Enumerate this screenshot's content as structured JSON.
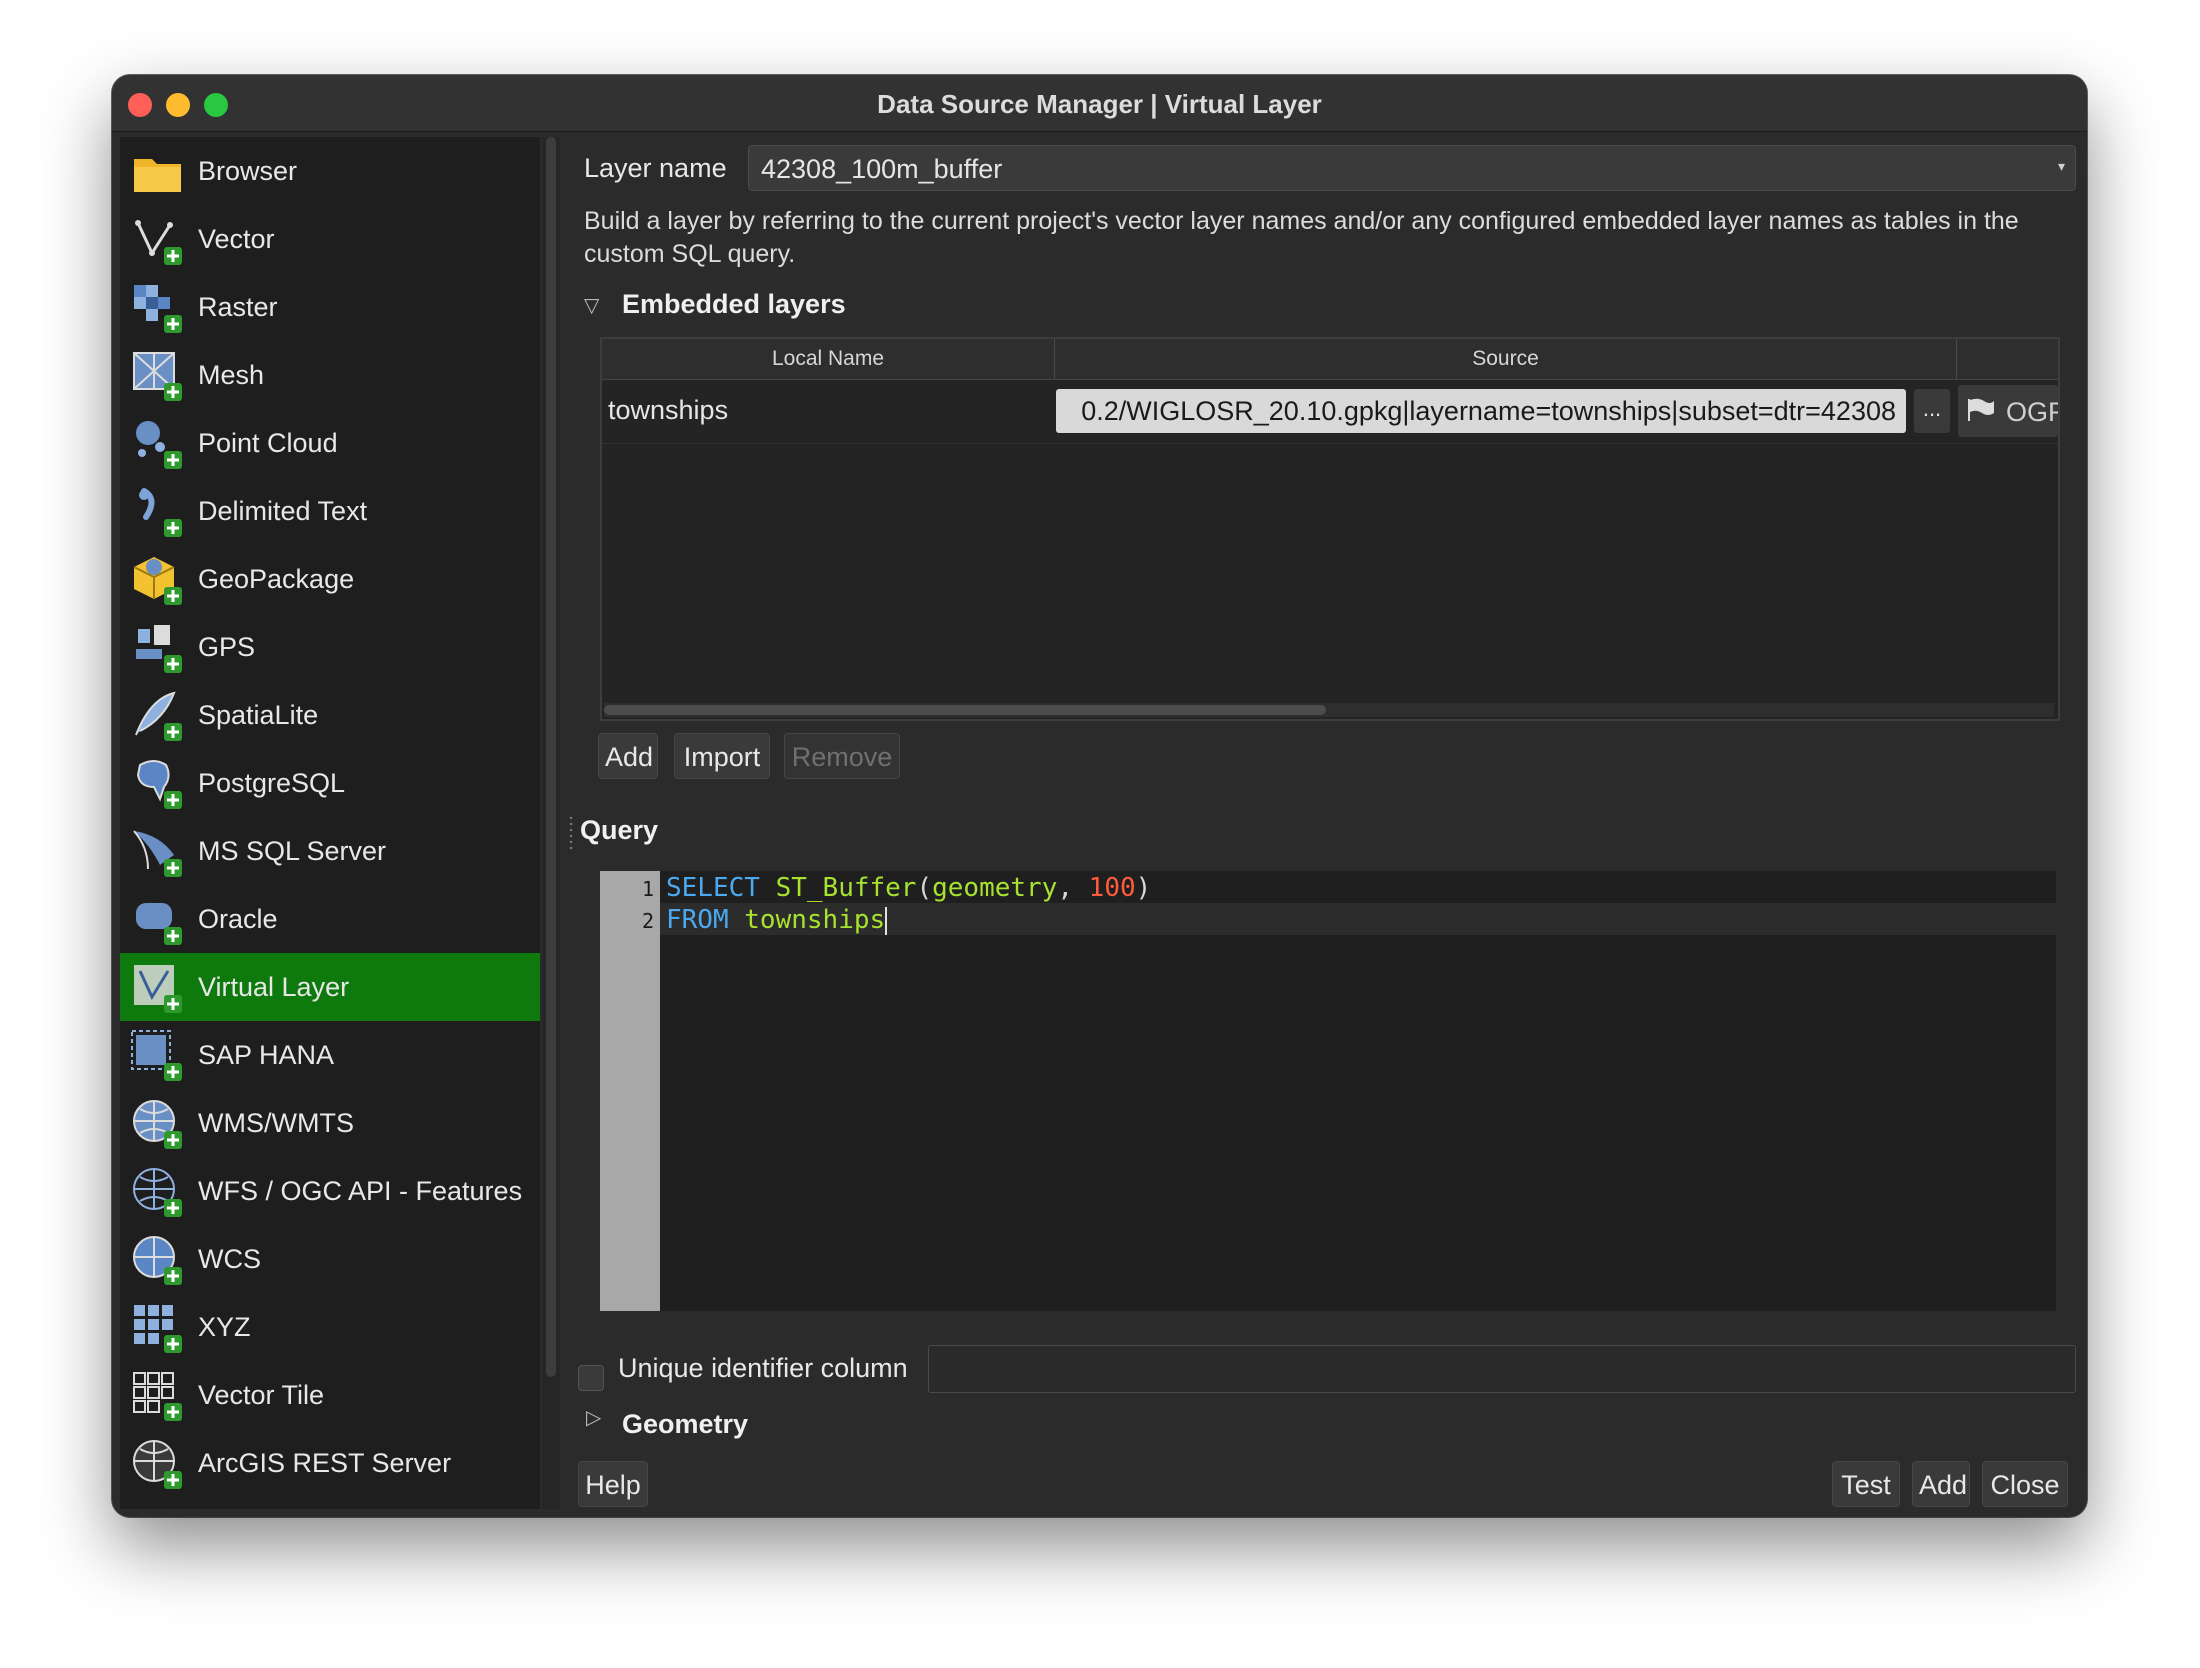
{
  "window": {
    "title": "Data Source Manager | Virtual Layer"
  },
  "sidebar": {
    "items": [
      {
        "label": "Browser",
        "icon": "folder-icon"
      },
      {
        "label": "Vector",
        "icon": "vector-add-icon"
      },
      {
        "label": "Raster",
        "icon": "raster-add-icon"
      },
      {
        "label": "Mesh",
        "icon": "mesh-add-icon"
      },
      {
        "label": "Point Cloud",
        "icon": "point-cloud-add-icon"
      },
      {
        "label": "Delimited Text",
        "icon": "delimited-text-add-icon"
      },
      {
        "label": "GeoPackage",
        "icon": "geopackage-add-icon"
      },
      {
        "label": "GPS",
        "icon": "gps-add-icon"
      },
      {
        "label": "SpatiaLite",
        "icon": "spatialite-add-icon"
      },
      {
        "label": "PostgreSQL",
        "icon": "postgresql-add-icon"
      },
      {
        "label": "MS SQL Server",
        "icon": "mssql-add-icon"
      },
      {
        "label": "Oracle",
        "icon": "oracle-add-icon"
      },
      {
        "label": "Virtual Layer",
        "icon": "virtual-layer-add-icon",
        "selected": true
      },
      {
        "label": "SAP HANA",
        "icon": "sap-hana-add-icon"
      },
      {
        "label": "WMS/WMTS",
        "icon": "wms-add-icon"
      },
      {
        "label": "WFS / OGC API - Features",
        "icon": "wfs-add-icon"
      },
      {
        "label": "WCS",
        "icon": "wcs-add-icon"
      },
      {
        "label": "XYZ",
        "icon": "xyz-add-icon"
      },
      {
        "label": "Vector Tile",
        "icon": "vector-tile-add-icon"
      },
      {
        "label": "ArcGIS REST Server",
        "icon": "arcgis-add-icon"
      }
    ],
    "selected_color": "#0e7a0d"
  },
  "layer": {
    "name_label": "Layer name",
    "name_value": "42308_100m_buffer",
    "description": "Build a layer by referring to the current project's vector layer names and/or any configured embedded layer names as tables in the custom SQL query."
  },
  "embedded": {
    "title": "Embedded layers",
    "columns": [
      "Local Name",
      "Source",
      ""
    ],
    "rows": [
      {
        "local_name": "townships",
        "source": "0.2/WIGLOSR_20.10.gpkg|layername=townships|subset=dtr=42308",
        "browse_label": "...",
        "provider": "OGR"
      }
    ],
    "buttons": {
      "add": "Add",
      "import": "Import",
      "remove": "Remove"
    }
  },
  "query": {
    "title": "Query",
    "line_numbers": [
      "1",
      "2"
    ],
    "tokens": {
      "l1_kw": "SELECT",
      "l1_fn": "ST_Buffer",
      "l1_open": "(",
      "l1_arg": "geometry",
      "l1_sep": ", ",
      "l1_num": "100",
      "l1_close": ")",
      "l2_kw": "FROM",
      "l2_tbl": "townships"
    }
  },
  "options": {
    "uid_label": "Unique identifier column",
    "uid_value": "",
    "geometry_title": "Geometry"
  },
  "footer": {
    "help": "Help",
    "test": "Test",
    "add": "Add",
    "close": "Close"
  }
}
